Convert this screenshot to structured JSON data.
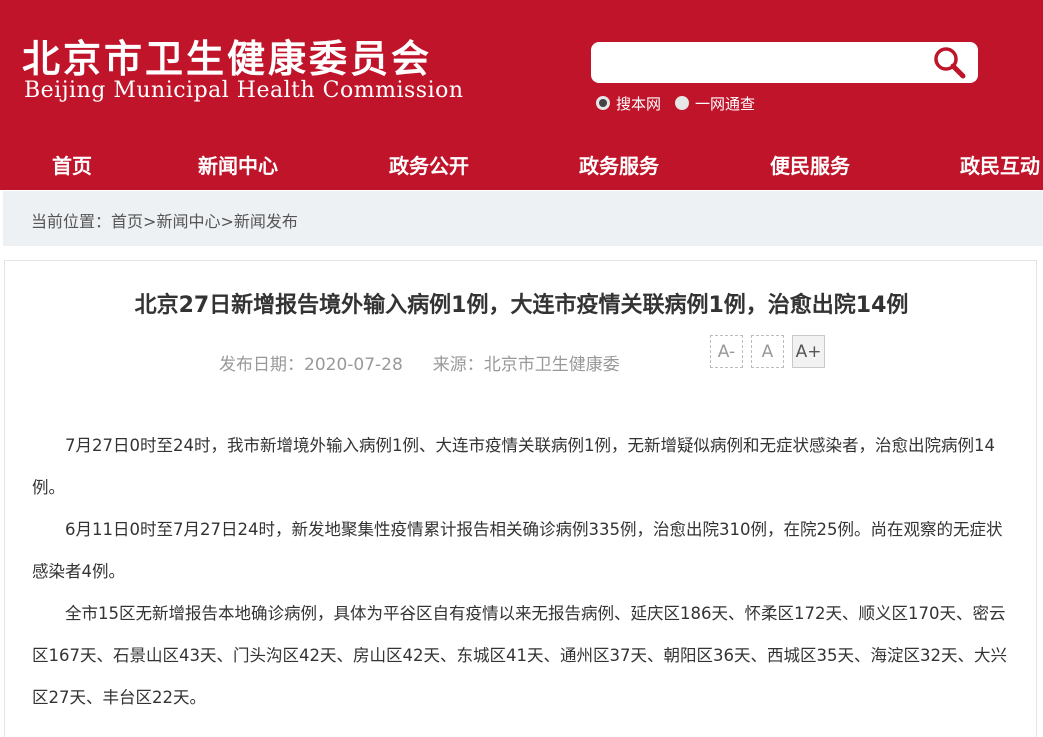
{
  "header": {
    "logo_cn": "北京市卫生健康委员会",
    "logo_en": "Beijing Municipal Health Commission",
    "search": {
      "placeholder": "",
      "value": ""
    },
    "radio_options": [
      {
        "label": "搜本网",
        "checked": true
      },
      {
        "label": "一网通查",
        "checked": false
      }
    ],
    "nav": [
      "首页",
      "新闻中心",
      "政务公开",
      "政务服务",
      "便民服务",
      "政民互动"
    ],
    "brand_color": "#c0142a"
  },
  "breadcrumb": {
    "prefix": "当前位置：",
    "items": [
      "首页",
      "新闻中心",
      "新闻发布"
    ],
    "separator": ">"
  },
  "article": {
    "title": "北京27日新增报告境外输入病例1例，大连市疫情关联病例1例，治愈出院14例",
    "date_label": "发布日期：2020-07-28",
    "source_label": "来源：北京市卫生健康委",
    "font_controls": [
      "A-",
      "A",
      "A+"
    ],
    "paragraphs": [
      "7月27日0时至24时，我市新增境外输入病例1例、大连市疫情关联病例1例，无新增疑似病例和无症状感染者，治愈出院病例14例。",
      "6月11日0时至7月27日24时，新发地聚集性疫情累计报告相关确诊病例335例，治愈出院310例，在院25例。尚在观察的无症状感染者4例。",
      "全市15区无新增报告本地确诊病例，具体为平谷区自有疫情以来无报告病例、延庆区186天、怀柔区172天、顺义区170天、密云区167天、石景山区43天、门头沟区42天、房山区42天、东城区41天、通州区37天、朝阳区36天、西城区35天、海淀区32天、大兴区27天、丰台区22天。"
    ]
  }
}
